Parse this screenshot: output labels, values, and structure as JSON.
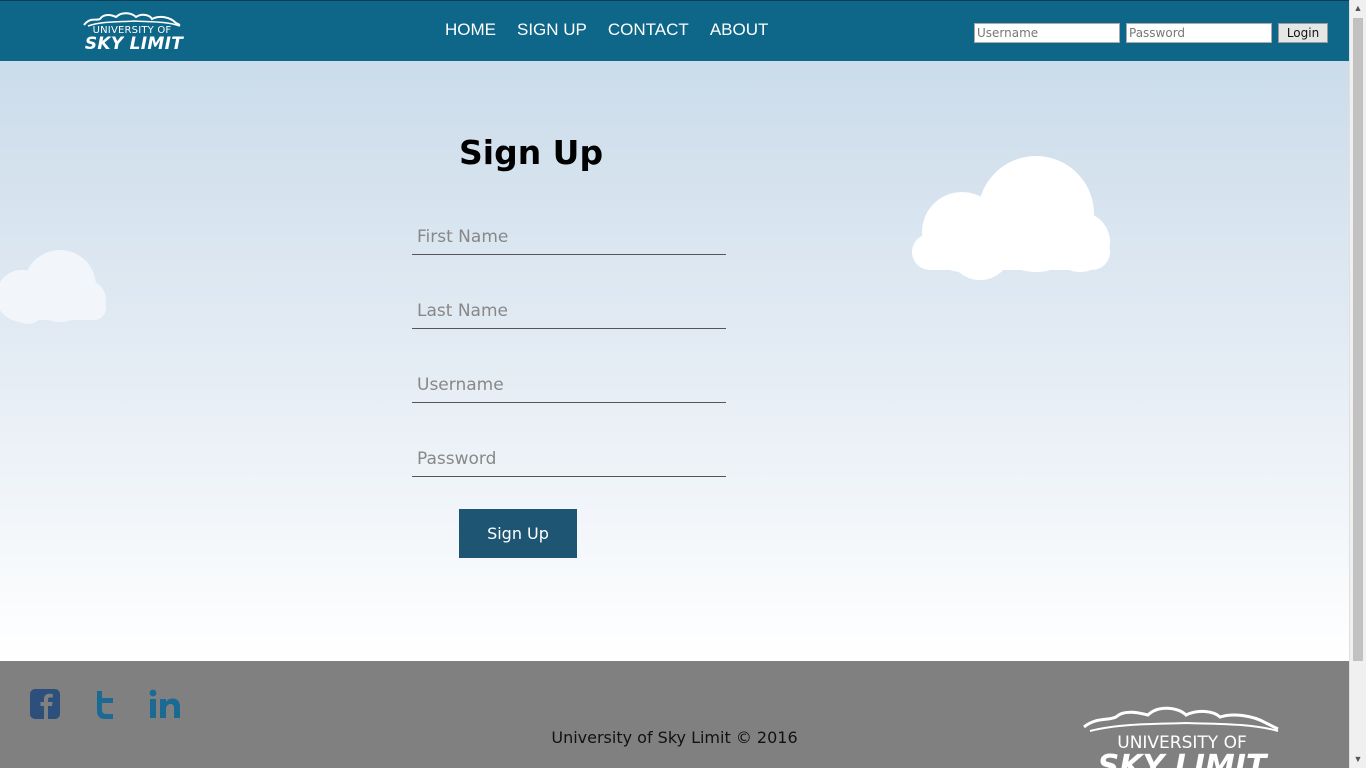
{
  "header": {
    "logo": {
      "top_text": "UNIVERSITY OF",
      "bottom_text": "SKY LIMIT"
    },
    "nav": [
      {
        "label": "HOME"
      },
      {
        "label": "SIGN UP"
      },
      {
        "label": "CONTACT"
      },
      {
        "label": "ABOUT"
      }
    ],
    "login": {
      "username_placeholder": "Username",
      "password_placeholder": "Password",
      "button_label": "Login"
    }
  },
  "form": {
    "title": "Sign Up",
    "first_name_placeholder": "First Name",
    "last_name_placeholder": "Last Name",
    "username_placeholder": "Username",
    "password_placeholder": "Password",
    "submit_label": "Sign Up"
  },
  "footer": {
    "social": [
      "facebook-icon",
      "twitter-icon",
      "linkedin-icon"
    ],
    "copyright": "University of Sky Limit © 2016",
    "logo": {
      "top_text": "UNIVERSITY OF",
      "bottom_text": "SKY LIMIT"
    }
  },
  "colors": {
    "header_bg": "#0e6688",
    "button_bg": "#1d5573",
    "footer_bg": "#808080",
    "social_blue": "#1a6a93",
    "facebook_blue": "#2a5a8a"
  }
}
